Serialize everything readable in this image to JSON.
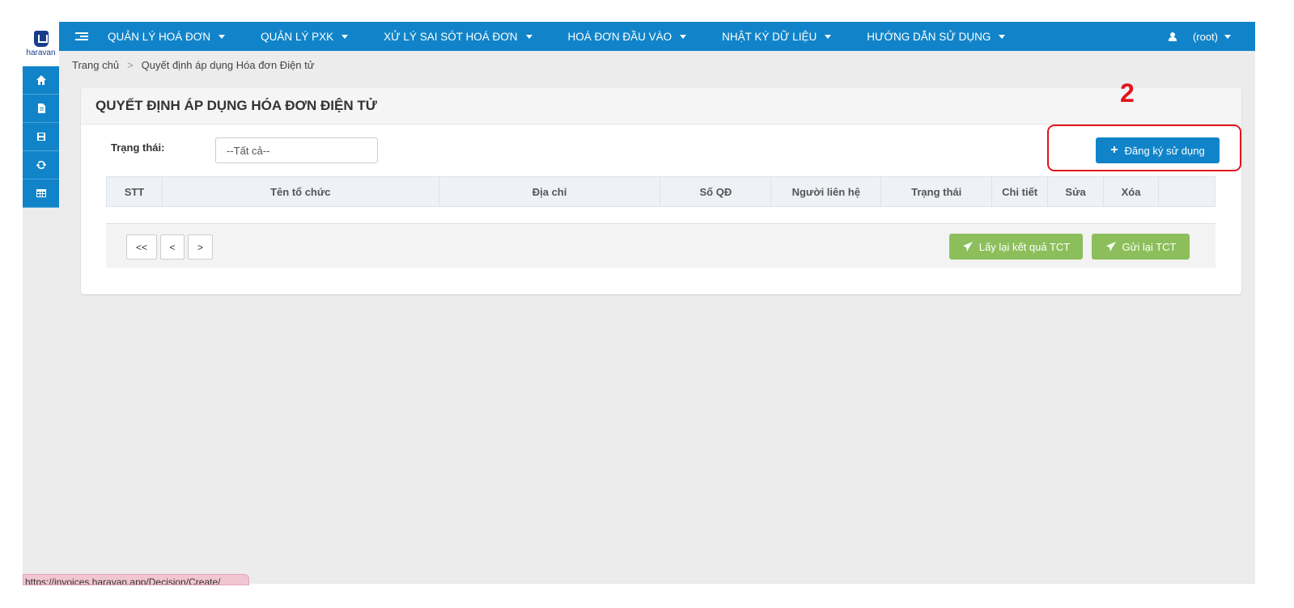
{
  "brand": {
    "logo_text": "haravan"
  },
  "topnav": {
    "items": [
      {
        "label": "QUẢN LÝ HOÁ ĐƠN"
      },
      {
        "label": "QUẢN LÝ PXK"
      },
      {
        "label": "XỬ LÝ SAI SÓT HOÁ ĐƠN"
      },
      {
        "label": "HOÁ ĐƠN ĐẦU VÀO"
      },
      {
        "label": "NHẬT KÝ DỮ LIỆU"
      },
      {
        "label": "HƯỚNG DẪN SỬ DỤNG"
      }
    ],
    "user": "(root)"
  },
  "sidebar": {
    "items": [
      {
        "icon": "home-icon"
      },
      {
        "icon": "document-icon"
      },
      {
        "icon": "save-icon"
      },
      {
        "icon": "refresh-icon"
      },
      {
        "icon": "table-icon"
      }
    ]
  },
  "breadcrumb": {
    "home": "Trang chủ",
    "separator": ">",
    "current": "Quyết định áp dụng Hóa đơn Điện tử"
  },
  "panel": {
    "title": "QUYẾT ĐỊNH ÁP DỤNG HÓA ĐƠN ĐIỆN TỬ",
    "filter_label": "Trạng thái:",
    "filter_value": "--Tất cả--",
    "register_label": "Đăng ký sử dụng",
    "annotation_number": "2"
  },
  "table": {
    "columns": [
      "STT",
      "Tên tổ chức",
      "Địa chỉ",
      "Số QĐ",
      "Người liên hệ",
      "Trạng thái",
      "Chi tiết",
      "Sửa",
      "Xóa",
      ""
    ]
  },
  "pager": {
    "first": "<<",
    "prev": "<",
    "next": ">"
  },
  "actions": {
    "fetch_result": "Lấy lại kết quả TCT",
    "resend": "Gửi lại TCT"
  },
  "status_bar": {
    "url": "https://invoices.haravan.app/Decision/Create/"
  },
  "colors": {
    "primary": "#1184c9",
    "success": "#8cbf5b",
    "annotation": "#e2141d"
  }
}
